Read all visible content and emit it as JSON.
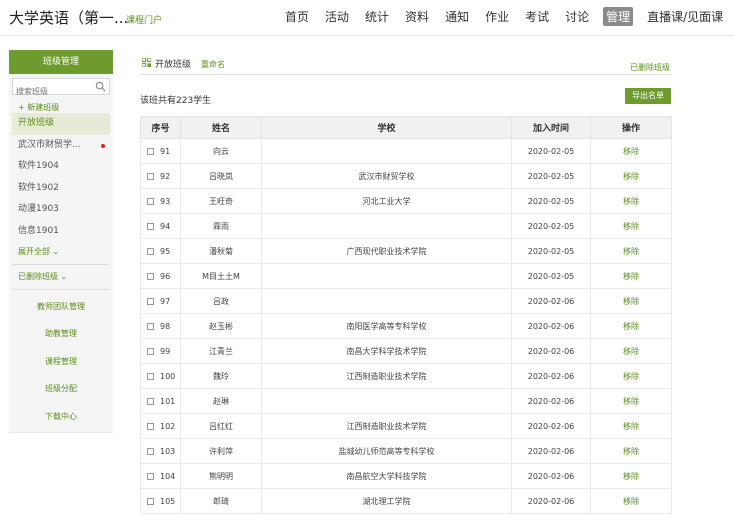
{
  "header": {
    "course_title": "大学英语（第一...",
    "portal_link": "课程门户",
    "nav": [
      "首页",
      "活动",
      "统计",
      "资料",
      "通知",
      "作业",
      "考试",
      "讨论",
      "管理",
      "直播课/见面课"
    ],
    "active_nav": "管理"
  },
  "sidebar": {
    "title": "班级管理",
    "search_placeholder": "搜索班级",
    "new_class": "+ 新建班级",
    "classes": [
      {
        "label": "开放班级",
        "active": true,
        "dot": false
      },
      {
        "label": "武汉市财贸学...",
        "active": false,
        "dot": true
      },
      {
        "label": "软件1904",
        "active": false,
        "dot": false
      },
      {
        "label": "软件1902",
        "active": false,
        "dot": false
      },
      {
        "label": "动漫1903",
        "active": false,
        "dot": false
      },
      {
        "label": "信息1901",
        "active": false,
        "dot": false
      }
    ],
    "expand_all": "展开全部 ⌄",
    "deleted_classes": "已删除班级 ⌄",
    "menu": [
      "教师团队管理",
      "助教管理",
      "课程管理",
      "班级分配",
      "下载中心"
    ]
  },
  "main": {
    "tab_label": "开放班级",
    "rename_label": "重命名",
    "deleted_label": "已删除班级",
    "count_text": "该班共有223学生",
    "export_label": "导出名单",
    "columns": [
      "序号",
      "姓名",
      "学校",
      "加入时间",
      "操作"
    ],
    "rows": [
      {
        "no": "91",
        "name": "向云",
        "school": "",
        "date": "2020-02-05",
        "action": "移除"
      },
      {
        "no": "92",
        "name": "吕晓岚",
        "school": "武汉市财贸学校",
        "date": "2020-02-05",
        "action": "移除"
      },
      {
        "no": "93",
        "name": "王旺奇",
        "school": "河北工业大学",
        "date": "2020-02-05",
        "action": "移除"
      },
      {
        "no": "94",
        "name": "霖雨",
        "school": "",
        "date": "2020-02-05",
        "action": "移除"
      },
      {
        "no": "95",
        "name": "潘秋菊",
        "school": "广西现代职业技术学院",
        "date": "2020-02-05",
        "action": "移除"
      },
      {
        "no": "96",
        "name": "M目土土M",
        "school": "",
        "date": "2020-02-05",
        "action": "移除"
      },
      {
        "no": "97",
        "name": "吕政",
        "school": "",
        "date": "2020-02-06",
        "action": "移除"
      },
      {
        "no": "98",
        "name": "赵玉彬",
        "school": "南阳医学高等专科学校",
        "date": "2020-02-06",
        "action": "移除"
      },
      {
        "no": "99",
        "name": "江青兰",
        "school": "南昌大学科学技术学院",
        "date": "2020-02-06",
        "action": "移除"
      },
      {
        "no": "100",
        "name": "魏玲",
        "school": "江西制造职业技术学院",
        "date": "2020-02-06",
        "action": "移除"
      },
      {
        "no": "101",
        "name": "赵琳",
        "school": "",
        "date": "2020-02-06",
        "action": "移除"
      },
      {
        "no": "102",
        "name": "吕红红",
        "school": "江西制造职业技术学院",
        "date": "2020-02-06",
        "action": "移除"
      },
      {
        "no": "103",
        "name": "许利萍",
        "school": "盐城幼儿师范高等专科学校",
        "date": "2020-02-06",
        "action": "移除"
      },
      {
        "no": "104",
        "name": "熊明明",
        "school": "南昌航空大学科技学院",
        "date": "2020-02-06",
        "action": "移除"
      },
      {
        "no": "105",
        "name": "郎琦",
        "school": "湖北理工学院",
        "date": "2020-02-06",
        "action": "移除"
      }
    ]
  },
  "colors": {
    "accent": "#6e9b2e",
    "link": "#5a8f1c",
    "nav_active": "#8a8a8a",
    "alert_dot": "#e02020"
  }
}
